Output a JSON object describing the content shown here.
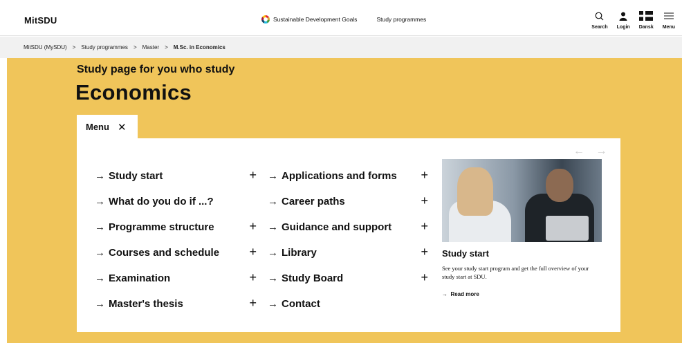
{
  "header": {
    "logo": "MitSDU",
    "nav": {
      "sdg_label": "Sustainable Development Goals",
      "programmes_label": "Study programmes"
    },
    "tools": [
      {
        "label": "Search",
        "icon": "search-icon"
      },
      {
        "label": "Login",
        "icon": "user-icon"
      },
      {
        "label": "Dansk",
        "icon": "danish-flag-icon"
      },
      {
        "label": "Menu",
        "icon": "hamburger-icon"
      }
    ]
  },
  "breadcrumb": {
    "items": [
      "MitSDU (MySDU)",
      "Study programmes",
      "Master"
    ],
    "current": "M.Sc. in Economics",
    "separator": ">"
  },
  "hero": {
    "subtitle": "Study page for you who study",
    "title": "Economics",
    "background": "#f0c55a"
  },
  "menu": {
    "tab_label": "Menu",
    "close_glyph": "✕",
    "arrow_glyph": "→",
    "plus_glyph": "+",
    "carousel_arrows": "← →",
    "left_items": [
      {
        "label": "Study start",
        "expandable": true
      },
      {
        "label": "What do you do if ...?",
        "expandable": false
      },
      {
        "label": "Programme structure",
        "expandable": true
      },
      {
        "label": "Courses and schedule",
        "expandable": true
      },
      {
        "label": "Examination",
        "expandable": true
      },
      {
        "label": "Master's thesis",
        "expandable": true
      }
    ],
    "right_items": [
      {
        "label": "Applications and forms",
        "expandable": true
      },
      {
        "label": "Career paths",
        "expandable": true
      },
      {
        "label": "Guidance and support",
        "expandable": true
      },
      {
        "label": "Library",
        "expandable": true
      },
      {
        "label": "Study Board",
        "expandable": true
      },
      {
        "label": "Contact",
        "expandable": false
      }
    ]
  },
  "feature": {
    "title": "Study start",
    "text": "See your study start program and get the full overview of your study start at SDU.",
    "link": "Read more"
  }
}
